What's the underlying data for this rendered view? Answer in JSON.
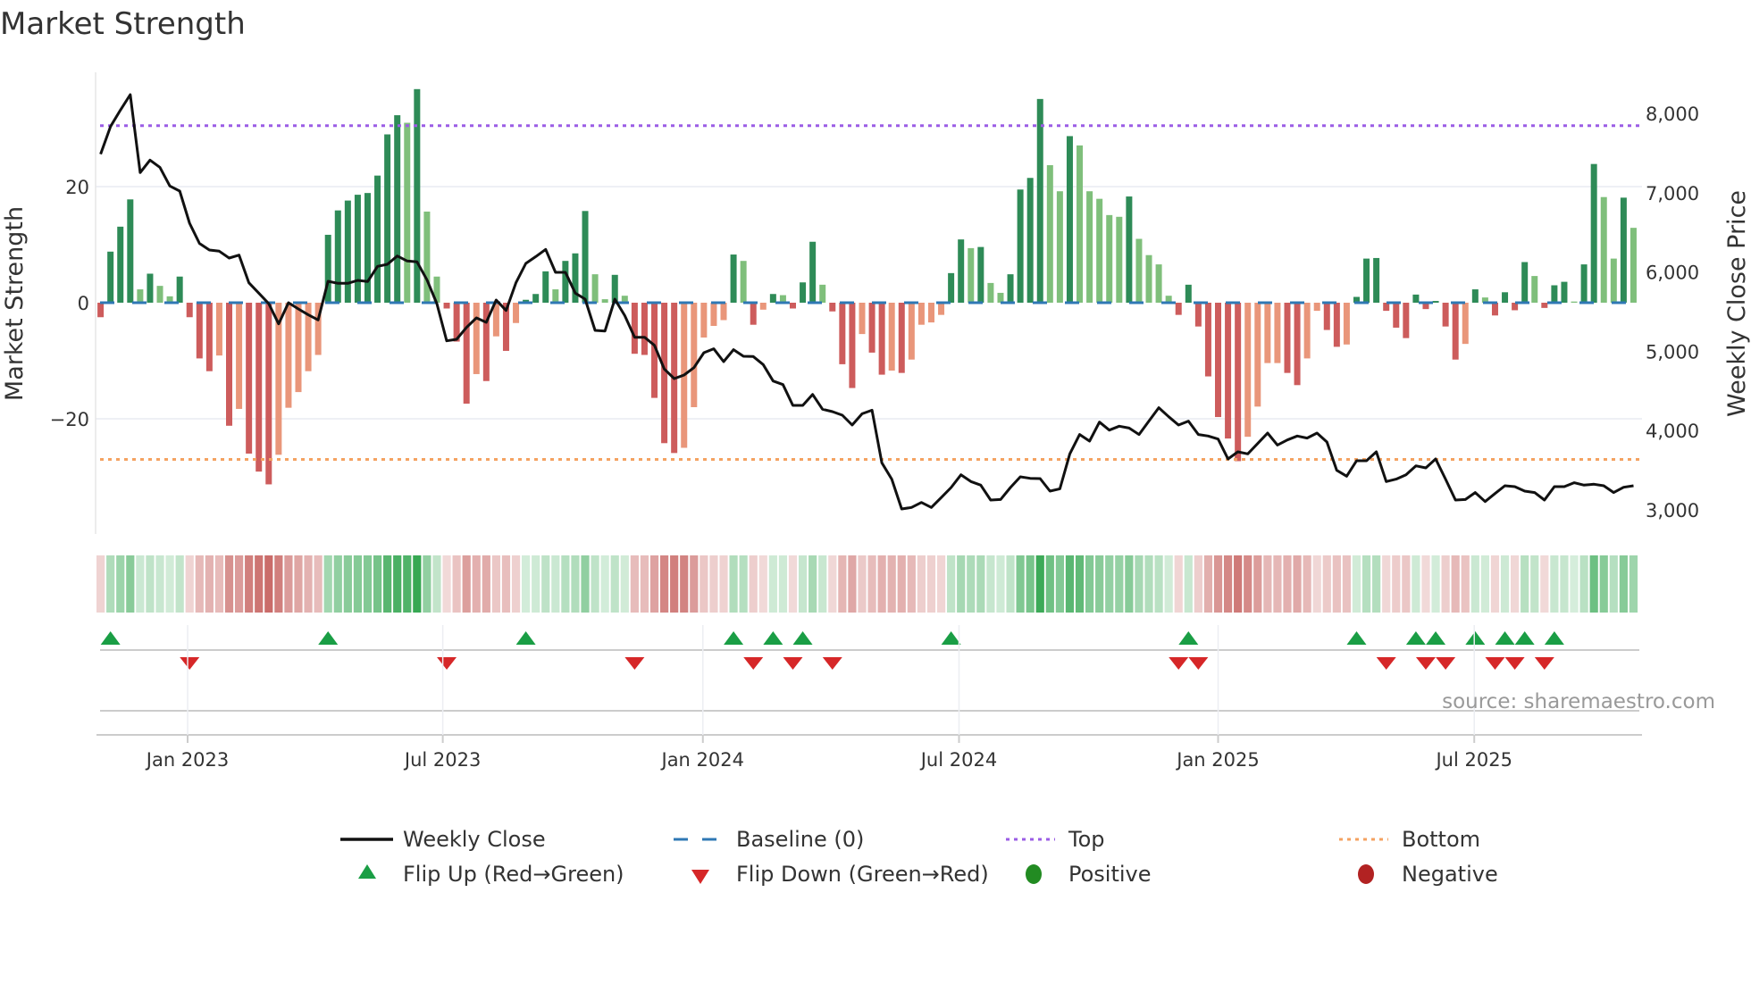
{
  "chart_data": {
    "type": "bar",
    "title": "Market Strength",
    "ylabel": "Market Strength",
    "y2label": "Weekly Close Price",
    "ylim": [
      -40,
      40
    ],
    "y2lim": [
      2500,
      8600
    ],
    "yticks": [
      {
        "v": 20,
        "label": "20"
      },
      {
        "v": 0,
        "label": "0"
      },
      {
        "v": -20,
        "label": "−20"
      }
    ],
    "y2ticks": [
      {
        "v": 8000,
        "label": "8,000"
      },
      {
        "v": 7000,
        "label": "7,000"
      },
      {
        "v": 6000,
        "label": "6,000"
      },
      {
        "v": 5000,
        "label": "5,000"
      },
      {
        "v": 4000,
        "label": "4,000"
      },
      {
        "v": 3000,
        "label": "3,000"
      }
    ],
    "xticks": [
      {
        "week": 8.8,
        "label": "Jan 2023"
      },
      {
        "week": 34.6,
        "label": "Jul 2023"
      },
      {
        "week": 60.9,
        "label": "Jan 2024"
      },
      {
        "week": 86.8,
        "label": "Jul 2024"
      },
      {
        "week": 113,
        "label": "Jan 2025"
      },
      {
        "week": 138.9,
        "label": "Jul 2025"
      }
    ],
    "top_level": 30.5,
    "bottom_level": -27,
    "baseline": 0,
    "strength": [
      -2.5,
      8.8,
      13.1,
      17.8,
      2.3,
      5.0,
      2.9,
      1.1,
      4.5,
      -2.5,
      -9.6,
      -11.8,
      -9.1,
      -21.2,
      -18.3,
      -26,
      -29.1,
      -31.3,
      -26.2,
      -18.1,
      -15.4,
      -11.8,
      -9.0,
      11.7,
      15.9,
      17.6,
      18.6,
      18.9,
      21.9,
      29,
      32.3,
      31,
      36.8,
      15.7,
      4.5,
      -1,
      -6.7,
      -17.4,
      -12.3,
      -13.5,
      -5.8,
      -8.3,
      -3.5,
      0.5,
      1.5,
      5.4,
      2.3,
      7.2,
      8.5,
      15.8,
      4.9,
      0.6,
      4.8,
      1.2,
      -8.8,
      -9,
      -16.4,
      -24.2,
      -25.9,
      -25,
      -18,
      -6,
      -4,
      -3,
      8.3,
      7.2,
      -3.8,
      -1.2,
      1.5,
      1.3,
      -1,
      3.5,
      10.5,
      3.1,
      -1.5,
      -10.6,
      -14.7,
      -5.4,
      -8.6,
      -12.4,
      -11.7,
      -12.1,
      -9.8,
      -3.8,
      -3.4,
      -2.1,
      5.1,
      10.9,
      9.4,
      9.6,
      3.4,
      1.7,
      4.9,
      19.5,
      21.5,
      35.1,
      23.7,
      19.2,
      28.7,
      27.1,
      19.2,
      17.9,
      15.1,
      14.8,
      18.3,
      11,
      8.2,
      6.6,
      1.2,
      -2.1,
      3.1,
      -4.1,
      -12.7,
      -19.7,
      -23.4,
      -27.3,
      -23.1,
      -17.9,
      -10.4,
      -10.4,
      -12.1,
      -14.2,
      -9.6,
      -1.4,
      -4.7,
      -7.6,
      -7.2,
      1,
      7.6,
      7.7,
      -1.4,
      -4.3,
      -6.1,
      1.4,
      -1.1,
      0.3,
      -4.1,
      -9.8,
      -7.1,
      2.3,
      0.9,
      -2.2,
      1.8,
      -1.3,
      7,
      4.6,
      -0.9,
      3,
      3.6,
      0.2,
      6.6,
      23.9,
      18.2,
      7.6,
      18.1,
      12.9
    ],
    "weekly_close": [
      7486,
      7835,
      8041,
      8236,
      7253,
      7411,
      7320,
      7084,
      7020,
      6615,
      6360,
      6277,
      6262,
      6176,
      6213,
      5864,
      5733,
      5601,
      5346,
      5613,
      5534,
      5459,
      5395,
      5883,
      5857,
      5857,
      5894,
      5880,
      6071,
      6097,
      6202,
      6138,
      6127,
      5902,
      5601,
      5132,
      5151,
      5301,
      5421,
      5365,
      5646,
      5515,
      5864,
      6108,
      6194,
      6285,
      5996,
      5996,
      5733,
      5658,
      5264,
      5256,
      5658,
      5451,
      5177,
      5177,
      5076,
      4776,
      4655,
      4700,
      4794,
      4982,
      5031,
      4869,
      5020,
      4937,
      4933,
      4832,
      4625,
      4580,
      4318,
      4318,
      4456,
      4269,
      4239,
      4194,
      4070,
      4212,
      4257,
      3593,
      3387,
      3011,
      3030,
      3094,
      3030,
      3154,
      3281,
      3443,
      3357,
      3312,
      3124,
      3131,
      3281,
      3417,
      3398,
      3394,
      3236,
      3266,
      3706,
      3950,
      3867,
      4107,
      4006,
      4055,
      4032,
      3950,
      4119,
      4288,
      4175,
      4070,
      4119,
      3950,
      3931,
      3893,
      3642,
      3732,
      3706,
      3837,
      3968,
      3818,
      3882,
      3931,
      3905,
      3968,
      3856,
      3499,
      3424,
      3619,
      3619,
      3732,
      3357,
      3387,
      3443,
      3555,
      3529,
      3642,
      3387,
      3124,
      3131,
      3218,
      3105,
      3206,
      3304,
      3293,
      3236,
      3218,
      3124,
      3293,
      3293,
      3342,
      3312,
      3323,
      3304,
      3218,
      3285,
      3304
    ],
    "legend": {
      "weekly_close": "Weekly Close",
      "baseline": "Baseline (0)",
      "top": "Top",
      "bottom": "Bottom",
      "flip_up": "Flip Up (Red→Green)",
      "flip_down": "Flip Down (Green→Red)",
      "positive": "Positive",
      "negative": "Negative"
    },
    "legend_position": "bottom",
    "source": "source: sharemaestro.com"
  },
  "colors": {
    "green_rising": "#2e8b57",
    "green_falling": "#7fbf7b",
    "red_falling": "#cd5c5c",
    "red_rising": "#e9967a",
    "baseline": "#2f78b4",
    "top": "#9b5de5",
    "bottom": "#f4a261",
    "flip_up": "#1a9e45",
    "flip_down": "#d62728",
    "positive": "#228b22",
    "negative": "#b22222",
    "price": "#111111"
  }
}
